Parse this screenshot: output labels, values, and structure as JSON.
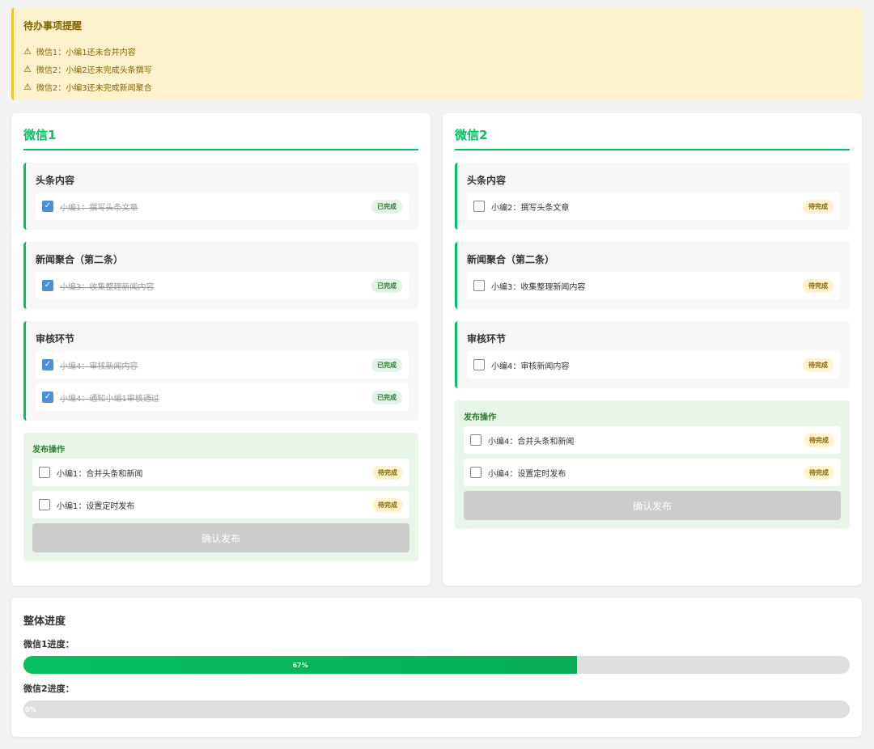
{
  "reminder": {
    "title": "待办事项提醒",
    "items": [
      "微信1：小编1还未合并内容",
      "微信2：小编2还未完成头条撰写",
      "微信2：小编3还未完成新闻聚合"
    ]
  },
  "wx1": {
    "title": "微信1",
    "sections": [
      {
        "title": "头条内容",
        "tasks": [
          {
            "label": "小编1：撰写头条文章",
            "status": "已完成"
          }
        ]
      },
      {
        "title": "新闻聚合（第二条）",
        "tasks": [
          {
            "label": "小编3：收集整理新闻内容",
            "status": "已完成"
          }
        ]
      },
      {
        "title": "审核环节",
        "tasks": [
          {
            "label": "小编4：审核新闻内容",
            "status": "已完成"
          },
          {
            "label": "小编4：通知小编1审核通过",
            "status": "已完成"
          }
        ]
      }
    ],
    "publish": {
      "title": "发布操作",
      "tasks": [
        {
          "label": "小编1：合并头条和新闻",
          "status": "待完成"
        },
        {
          "label": "小编1：设置定时发布",
          "status": "待完成"
        }
      ],
      "button": "确认发布"
    }
  },
  "wx2": {
    "title": "微信2",
    "sections": [
      {
        "title": "头条内容",
        "tasks": [
          {
            "label": "小编2：撰写头条文章",
            "status": "待完成"
          }
        ]
      },
      {
        "title": "新闻聚合（第二条）",
        "tasks": [
          {
            "label": "小编3：收集整理新闻内容",
            "status": "待完成"
          }
        ]
      },
      {
        "title": "审核环节",
        "tasks": [
          {
            "label": "小编4：审核新闻内容",
            "status": "待完成"
          }
        ]
      }
    ],
    "publish": {
      "title": "发布操作",
      "tasks": [
        {
          "label": "小编4：合并头条和新闻",
          "status": "待完成"
        },
        {
          "label": "小编4：设置定时发布",
          "status": "待完成"
        }
      ],
      "button": "确认发布"
    }
  },
  "progress": {
    "title": "整体进度",
    "wx1_label": "微信1进度：",
    "wx1_percent": 67,
    "wx1_text": "67%",
    "wx2_label": "微信2进度：",
    "wx2_percent": 0,
    "wx2_text": "0%"
  },
  "colors": {
    "accent": "#07c160",
    "checkbox_checked": "#4a90d9",
    "reminder_bg": "#fff3cd",
    "button_disabled": "#cccccc"
  },
  "icons": {
    "warning": "warning-icon",
    "check": "checkmark-icon"
  }
}
